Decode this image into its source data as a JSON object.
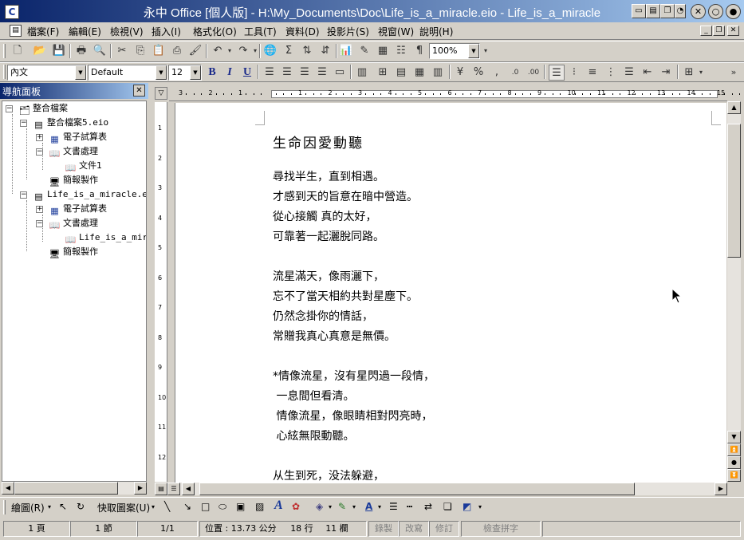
{
  "window": {
    "title": "永中 Office [個人版] - H:\\My_Documents\\Doc\\Life_is_a_miracle.eio - Life_is_a_miracle",
    "app_icon_letter": "C"
  },
  "menu": {
    "items": [
      "檔案(F)",
      "編輯(E)",
      "檢視(V)",
      "插入(I)",
      "格式化(O)",
      "工具(T)",
      "資料(D)",
      "投影片(S)",
      "視窗(W)",
      "說明(H)"
    ]
  },
  "format_toolbar": {
    "style_value": "內文",
    "font_value": "Default",
    "size_value": "12",
    "zoom_value": "100%",
    "bold_label": "B",
    "italic_label": "I",
    "underline_label": "U"
  },
  "nav_panel": {
    "title": "導航面板",
    "root": "整合檔案",
    "file1": "整合檔案5.eio",
    "file1_children": [
      "電子試算表",
      "文書處理",
      "文件1",
      "簡報製作"
    ],
    "file2": "Life_is_a_miracle.eio",
    "file2_children": [
      "電子試算表",
      "文書處理",
      "Life_is_a_miracle",
      "簡報製作"
    ]
  },
  "document": {
    "title": "生命因愛動聽",
    "stanzas": [
      [
        "尋找半生，直到相遇。",
        "才感到天的旨意在暗中營造。",
        "從心接觸 真的太好，",
        "可靠著一起灑脫同路。"
      ],
      [
        "流星滿天，像雨灑下，",
        "忘不了當天相約共對星塵下。",
        "仍然念掛你的情話，",
        "常贈我真心真意是無價。"
      ],
      [
        "*情像流星，沒有星閃過一段情，",
        " 一息間但看清。",
        " 情像流星，像眼睛相對閃亮時，",
        " 心絃無限動聽。"
      ],
      [
        "从生到死，没法躲避，"
      ]
    ]
  },
  "drawing_toolbar": {
    "draw_label": "繪圖(R)",
    "autoshape_label": "快取圖案(U)"
  },
  "statusbar": {
    "page": "1 頁",
    "section": "1 節",
    "page_of": "1/1",
    "position": "位置 : 13.73 公分",
    "line": "18 行",
    "column": "11 欄",
    "rec": "錄製",
    "trk": "改寫",
    "ext": "修訂",
    "spell": "檢查拼字"
  }
}
